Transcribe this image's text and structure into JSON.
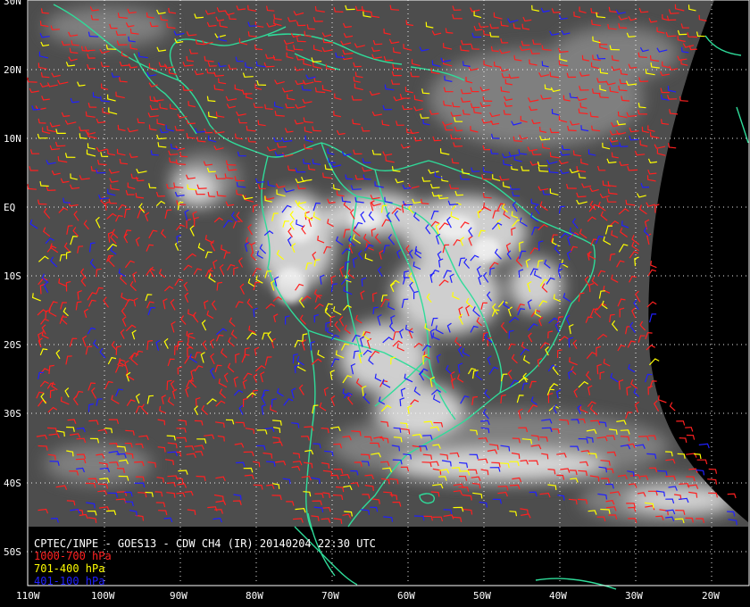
{
  "title": "CPTEC/INPE - GOES13 - CDW CH4 (IR) 20140204 22:30 UTC",
  "legend": [
    {
      "label": "1000-700 hPa",
      "color": "#ff2020"
    },
    {
      "label": "701-400 hPa",
      "color": "#ffff00"
    },
    {
      "label": "401-100 hPa",
      "color": "#2020ff"
    }
  ],
  "lat_labels": [
    "30N",
    "20N",
    "10N",
    "EQ",
    "10S",
    "20S",
    "30S",
    "40S",
    "50S"
  ],
  "lon_labels": [
    "110W",
    "100W",
    "90W",
    "80W",
    "70W",
    "60W",
    "50W",
    "40W",
    "30W",
    "20W"
  ],
  "colors": {
    "background": "#000000",
    "coastline": "#2fdc9a",
    "grid": "#ffffff",
    "imagery_base": "#4a4a4a"
  }
}
